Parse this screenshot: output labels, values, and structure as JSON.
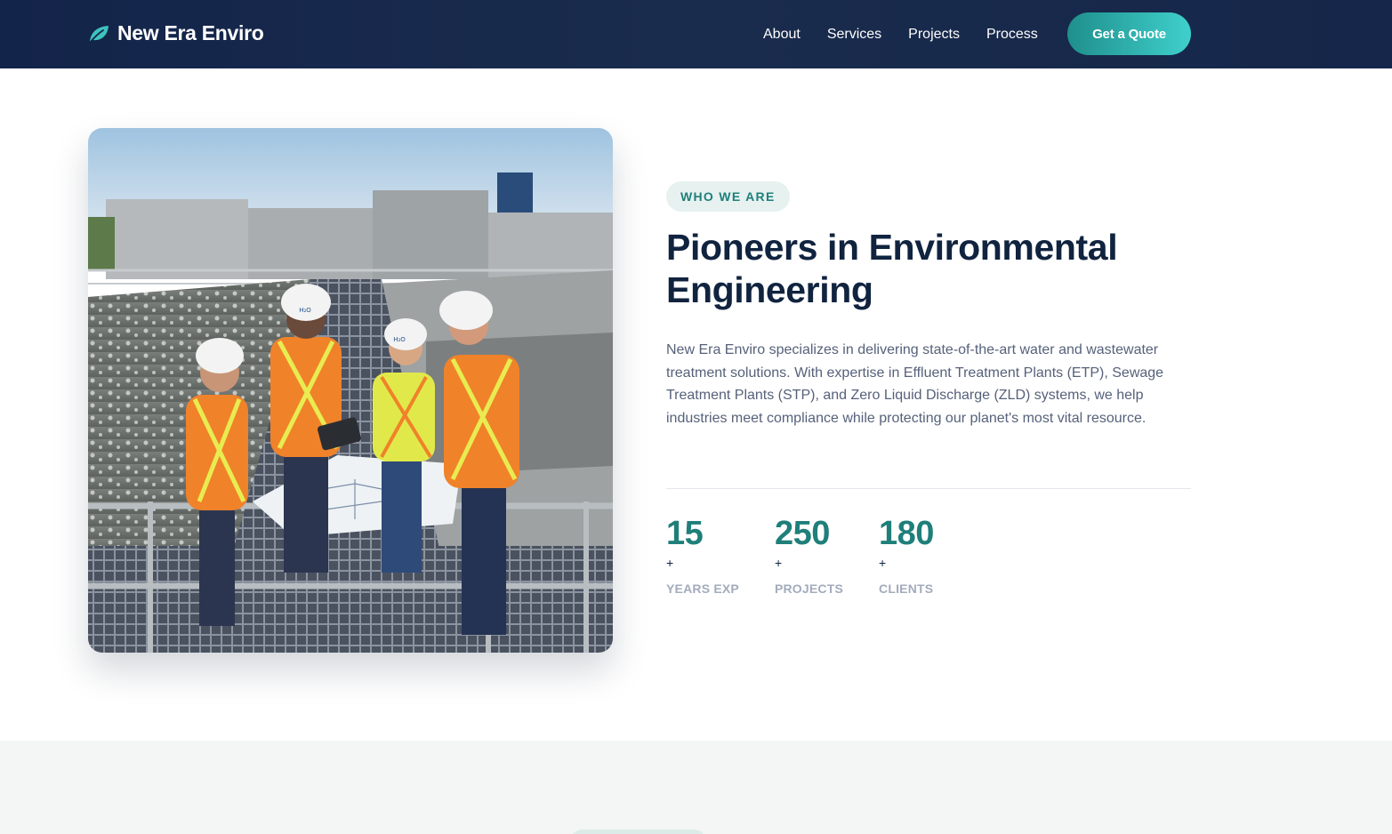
{
  "nav": {
    "brand": "New Era Enviro",
    "links": [
      "About",
      "Services",
      "Projects",
      "Process"
    ],
    "cta": "Get a Quote"
  },
  "about": {
    "eyebrow": "WHO WE ARE",
    "headline_line1": "Pioneers in Environmental",
    "headline_line2": "Engineering",
    "description": "New Era Enviro specializes in delivering state-of-the-art water and wastewater treatment solutions. With expertise in Effluent Treatment Plants (ETP), Sewage Treatment Plants (STP), and Zero Liquid Discharge (ZLD) systems, we help industries meet compliance while protecting our planet's most vital resource.",
    "stats": [
      {
        "value": "15",
        "suffix": "+",
        "label": "YEARS EXP"
      },
      {
        "value": "250",
        "suffix": "+",
        "label": "PROJECTS"
      },
      {
        "value": "180",
        "suffix": "+",
        "label": "CLIENTS"
      }
    ]
  },
  "colors": {
    "nav_bg": "#13244a",
    "accent": "#1f7f7a",
    "cta_gradient_start": "#1f8f8c",
    "cta_gradient_end": "#3fd0cc",
    "heading": "#10233f"
  },
  "icons": {
    "brand": "leaf-icon"
  },
  "hero_image": {
    "helmet_text": "H₂O"
  }
}
